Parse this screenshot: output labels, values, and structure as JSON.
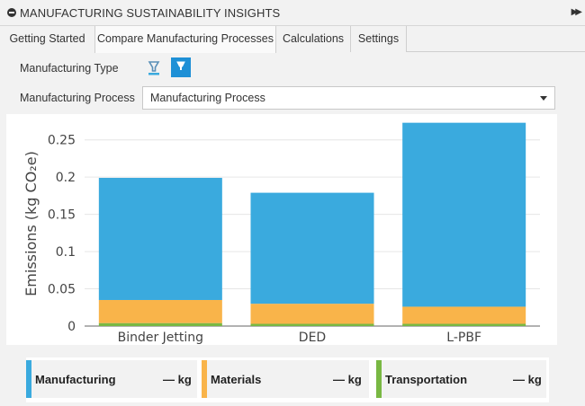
{
  "header": {
    "title": "MANUFACTURING SUSTAINABILITY INSIGHTS"
  },
  "tabs": [
    {
      "label": "Getting Started"
    },
    {
      "label": "Compare Manufacturing Processes"
    },
    {
      "label": "Calculations"
    },
    {
      "label": "Settings"
    }
  ],
  "form": {
    "manufacturing_type_label": "Manufacturing Type",
    "manufacturing_process_label": "Manufacturing Process",
    "manufacturing_process_value": "Manufacturing Process"
  },
  "colors": {
    "manufacturing": "#3aaade",
    "materials": "#f9b44a",
    "transportation": "#79b843",
    "active_icon": "#1e90d6"
  },
  "chart_data": {
    "type": "bar",
    "stacked": true,
    "categories": [
      "Binder Jetting",
      "DED",
      "L-PBF"
    ],
    "series": [
      {
        "name": "Transportation",
        "values": [
          0.004,
          0.003,
          0.003
        ]
      },
      {
        "name": "Materials",
        "values": [
          0.031,
          0.027,
          0.023
        ]
      },
      {
        "name": "Manufacturing",
        "values": [
          0.164,
          0.149,
          0.247
        ]
      }
    ],
    "ylabel": "Emissions (kg CO₂e)",
    "yticks": [
      "0",
      "0.05",
      "0.1",
      "0.15",
      "0.2",
      "0.25"
    ],
    "ylim": [
      0,
      0.275
    ],
    "grid": true
  },
  "legend": [
    {
      "name": "Manufacturing",
      "value": "— kg"
    },
    {
      "name": "Materials",
      "value": "— kg"
    },
    {
      "name": "Transportation",
      "value": "— kg"
    }
  ]
}
